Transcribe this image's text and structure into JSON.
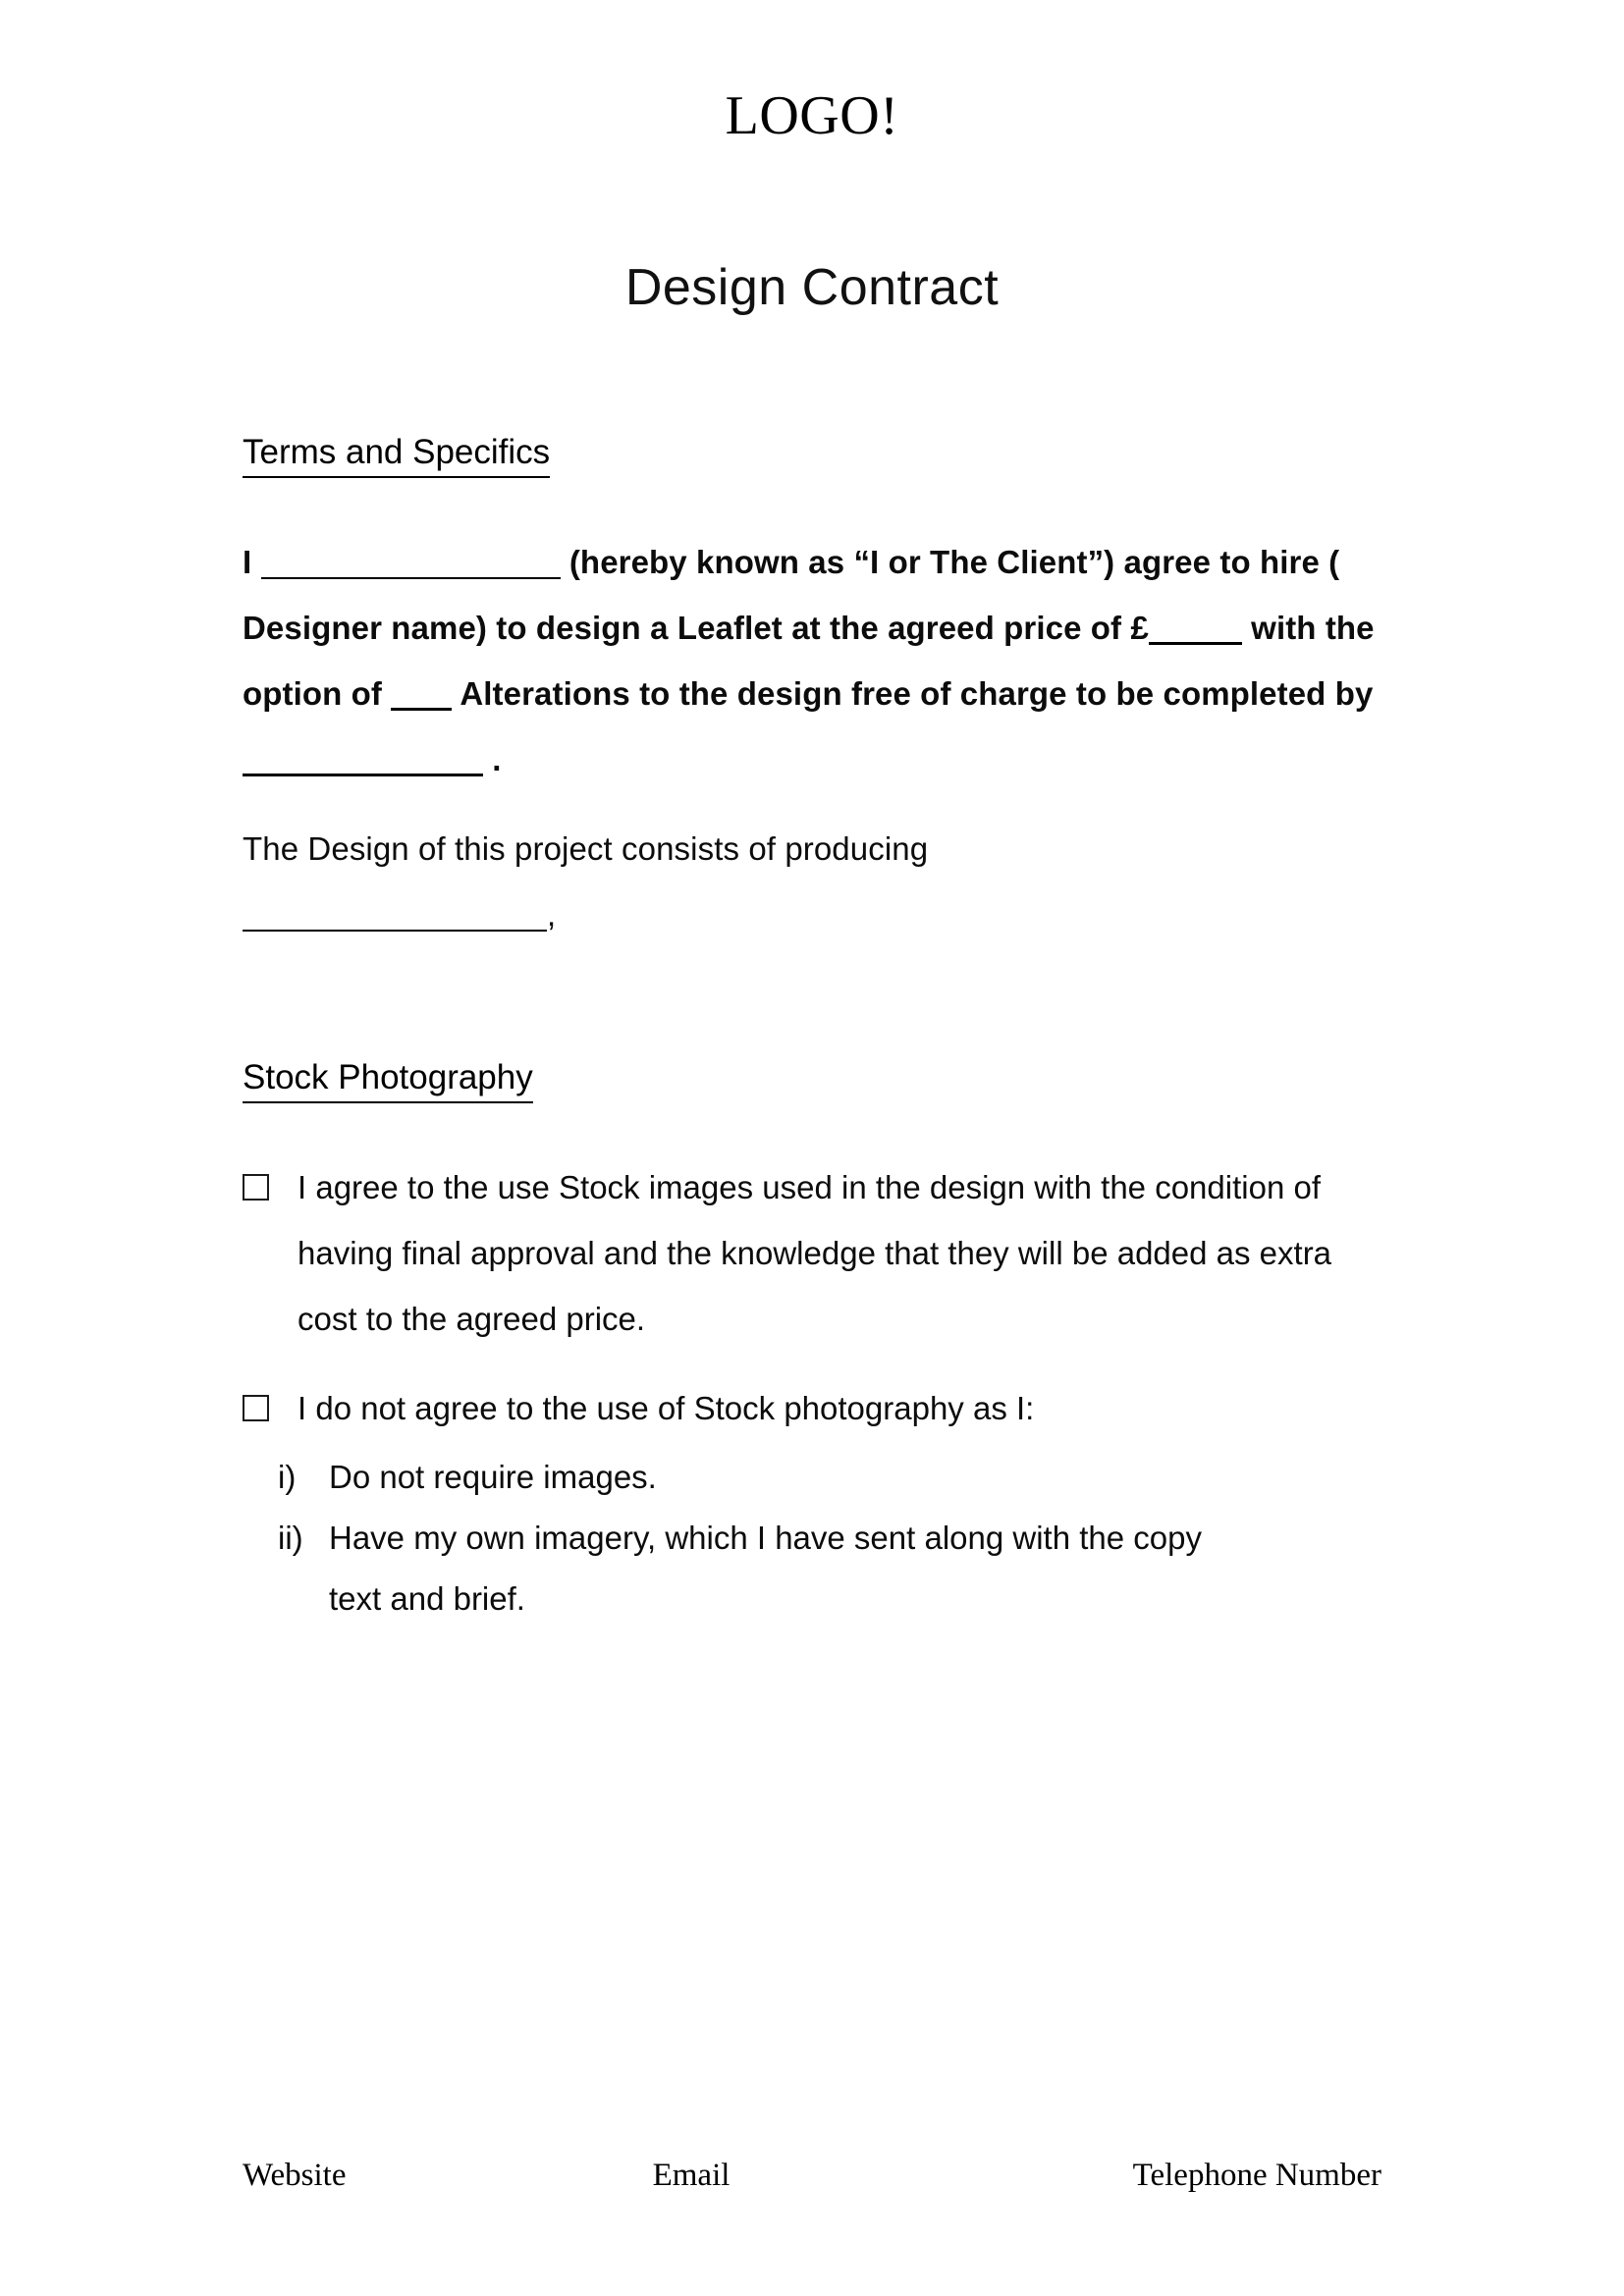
{
  "header": {
    "logo": "LOGO!",
    "title": "Design Contract"
  },
  "sections": {
    "terms": {
      "heading": "Terms and Specifics",
      "line1_a": "I",
      "line1_b": "(hereby known as “I or The Client”) agree to",
      "line2_a": "hire ( Designer name) to design a",
      "line2_bold": "Leaflet",
      "line2_b": "at the agreed price of",
      "line2_currency": "£",
      "line3_a": "with the option of",
      "line3_b": "Alterations to the design free of charge to be",
      "line4_a": "completed by",
      "line4_b": ".",
      "producing_a": "The Design of this project consists of producing",
      "producing_b": ","
    },
    "stock": {
      "heading": "Stock Photography",
      "option1": "I agree to the use Stock images used in the design with the condition of having final approval and the knowledge that they will be added as extra cost to the agreed price.",
      "option2": "I do not agree to the use of Stock photography as I:",
      "sub_items": [
        {
          "marker": "i)",
          "text": "Do not require images."
        },
        {
          "marker": "ii)",
          "text": "Have my own imagery, which I have sent along with the copy text and brief."
        }
      ]
    }
  },
  "footer": {
    "website": "Website",
    "email": "Email",
    "telephone": "Telephone Number"
  }
}
